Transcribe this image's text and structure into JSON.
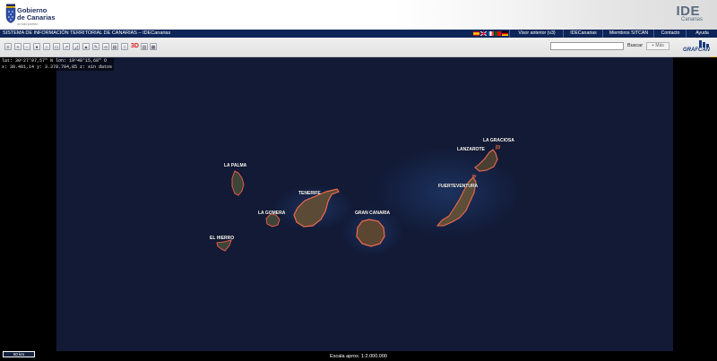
{
  "header": {
    "logo_line1": "Gobierno",
    "logo_line2": "de Canarias",
    "logo_tagline": "un solo pueblo",
    "brand_title": "IDE",
    "brand_subtitle": "Canarias"
  },
  "navbar": {
    "title": "SISTEMA DE INFORMACIÓN TERRITORIAL DE CANARIAS – IDECanarias",
    "links": [
      "Visor anterior (v3)",
      "IDECanarias",
      "Miembros SITCAN",
      "Contacto",
      "Ayuda"
    ]
  },
  "toolbar": {
    "button_3d": "3D",
    "search_button": "Buscar",
    "more_button": "+ Más",
    "brand": "GRAFCAN"
  },
  "map": {
    "coords_line1": "lat: 30º27'07,57\" N  lon: 19º48'15,68\" O",
    "coords_line2": "x: 38.481,14  y: 3.378.704,85  z: sin datos",
    "islands": {
      "la_palma": "LA PALMA",
      "tenerife": "TENERIFE",
      "la_gomera": "LA GOMERA",
      "el_hierro": "EL HIERRO",
      "gran_canaria": "GRAN CANARIA",
      "fuerteventura": "FUERTEVENTURA",
      "lanzarote": "LANZAROTE",
      "la_graciosa": "LA GRACIOSA"
    },
    "scalebar": "50 km",
    "scale_text": "Escala aprox. 1:2.000.000"
  },
  "colors": {
    "navbar": "#0d2559",
    "map_ocean": "#121a36",
    "coast": "#e45a4a"
  }
}
